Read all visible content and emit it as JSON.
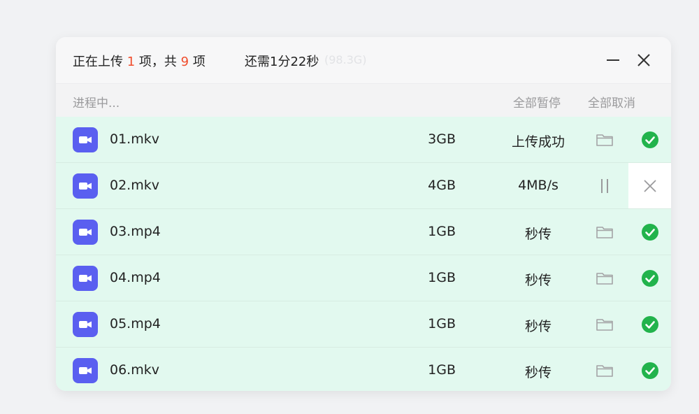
{
  "header": {
    "title_prefix": "正在上传 ",
    "uploading_count": "1",
    "title_mid": " 项，共 ",
    "total_count": "9",
    "title_suffix": " 项",
    "eta": "还需1分22秒",
    "eta_faint": "(98.3G)"
  },
  "subbar": {
    "progress_label": "进程中...",
    "pause_all": "全部暂停",
    "cancel_all": "全部取消"
  },
  "colors": {
    "accent_orange": "#f04d2d",
    "file_icon": "#5a5ff0",
    "row_bg": "#e2f9ef",
    "success_green": "#22b34c"
  },
  "files": [
    {
      "name": "01.mkv",
      "size": "3GB",
      "status": "上传成功",
      "action_icon": "folder-icon",
      "end_icon": "check-circle-icon"
    },
    {
      "name": "02.mkv",
      "size": "4GB",
      "status": "4MB/s",
      "action_icon": "pause-icon",
      "end_icon": "close-icon"
    },
    {
      "name": "03.mp4",
      "size": "1GB",
      "status": "秒传",
      "action_icon": "folder-icon",
      "end_icon": "check-circle-icon"
    },
    {
      "name": "04.mp4",
      "size": "1GB",
      "status": "秒传",
      "action_icon": "folder-icon",
      "end_icon": "check-circle-icon"
    },
    {
      "name": "05.mp4",
      "size": "1GB",
      "status": "秒传",
      "action_icon": "folder-icon",
      "end_icon": "check-circle-icon"
    },
    {
      "name": "06.mkv",
      "size": "1GB",
      "status": "秒传",
      "action_icon": "folder-icon",
      "end_icon": "check-circle-icon"
    }
  ]
}
